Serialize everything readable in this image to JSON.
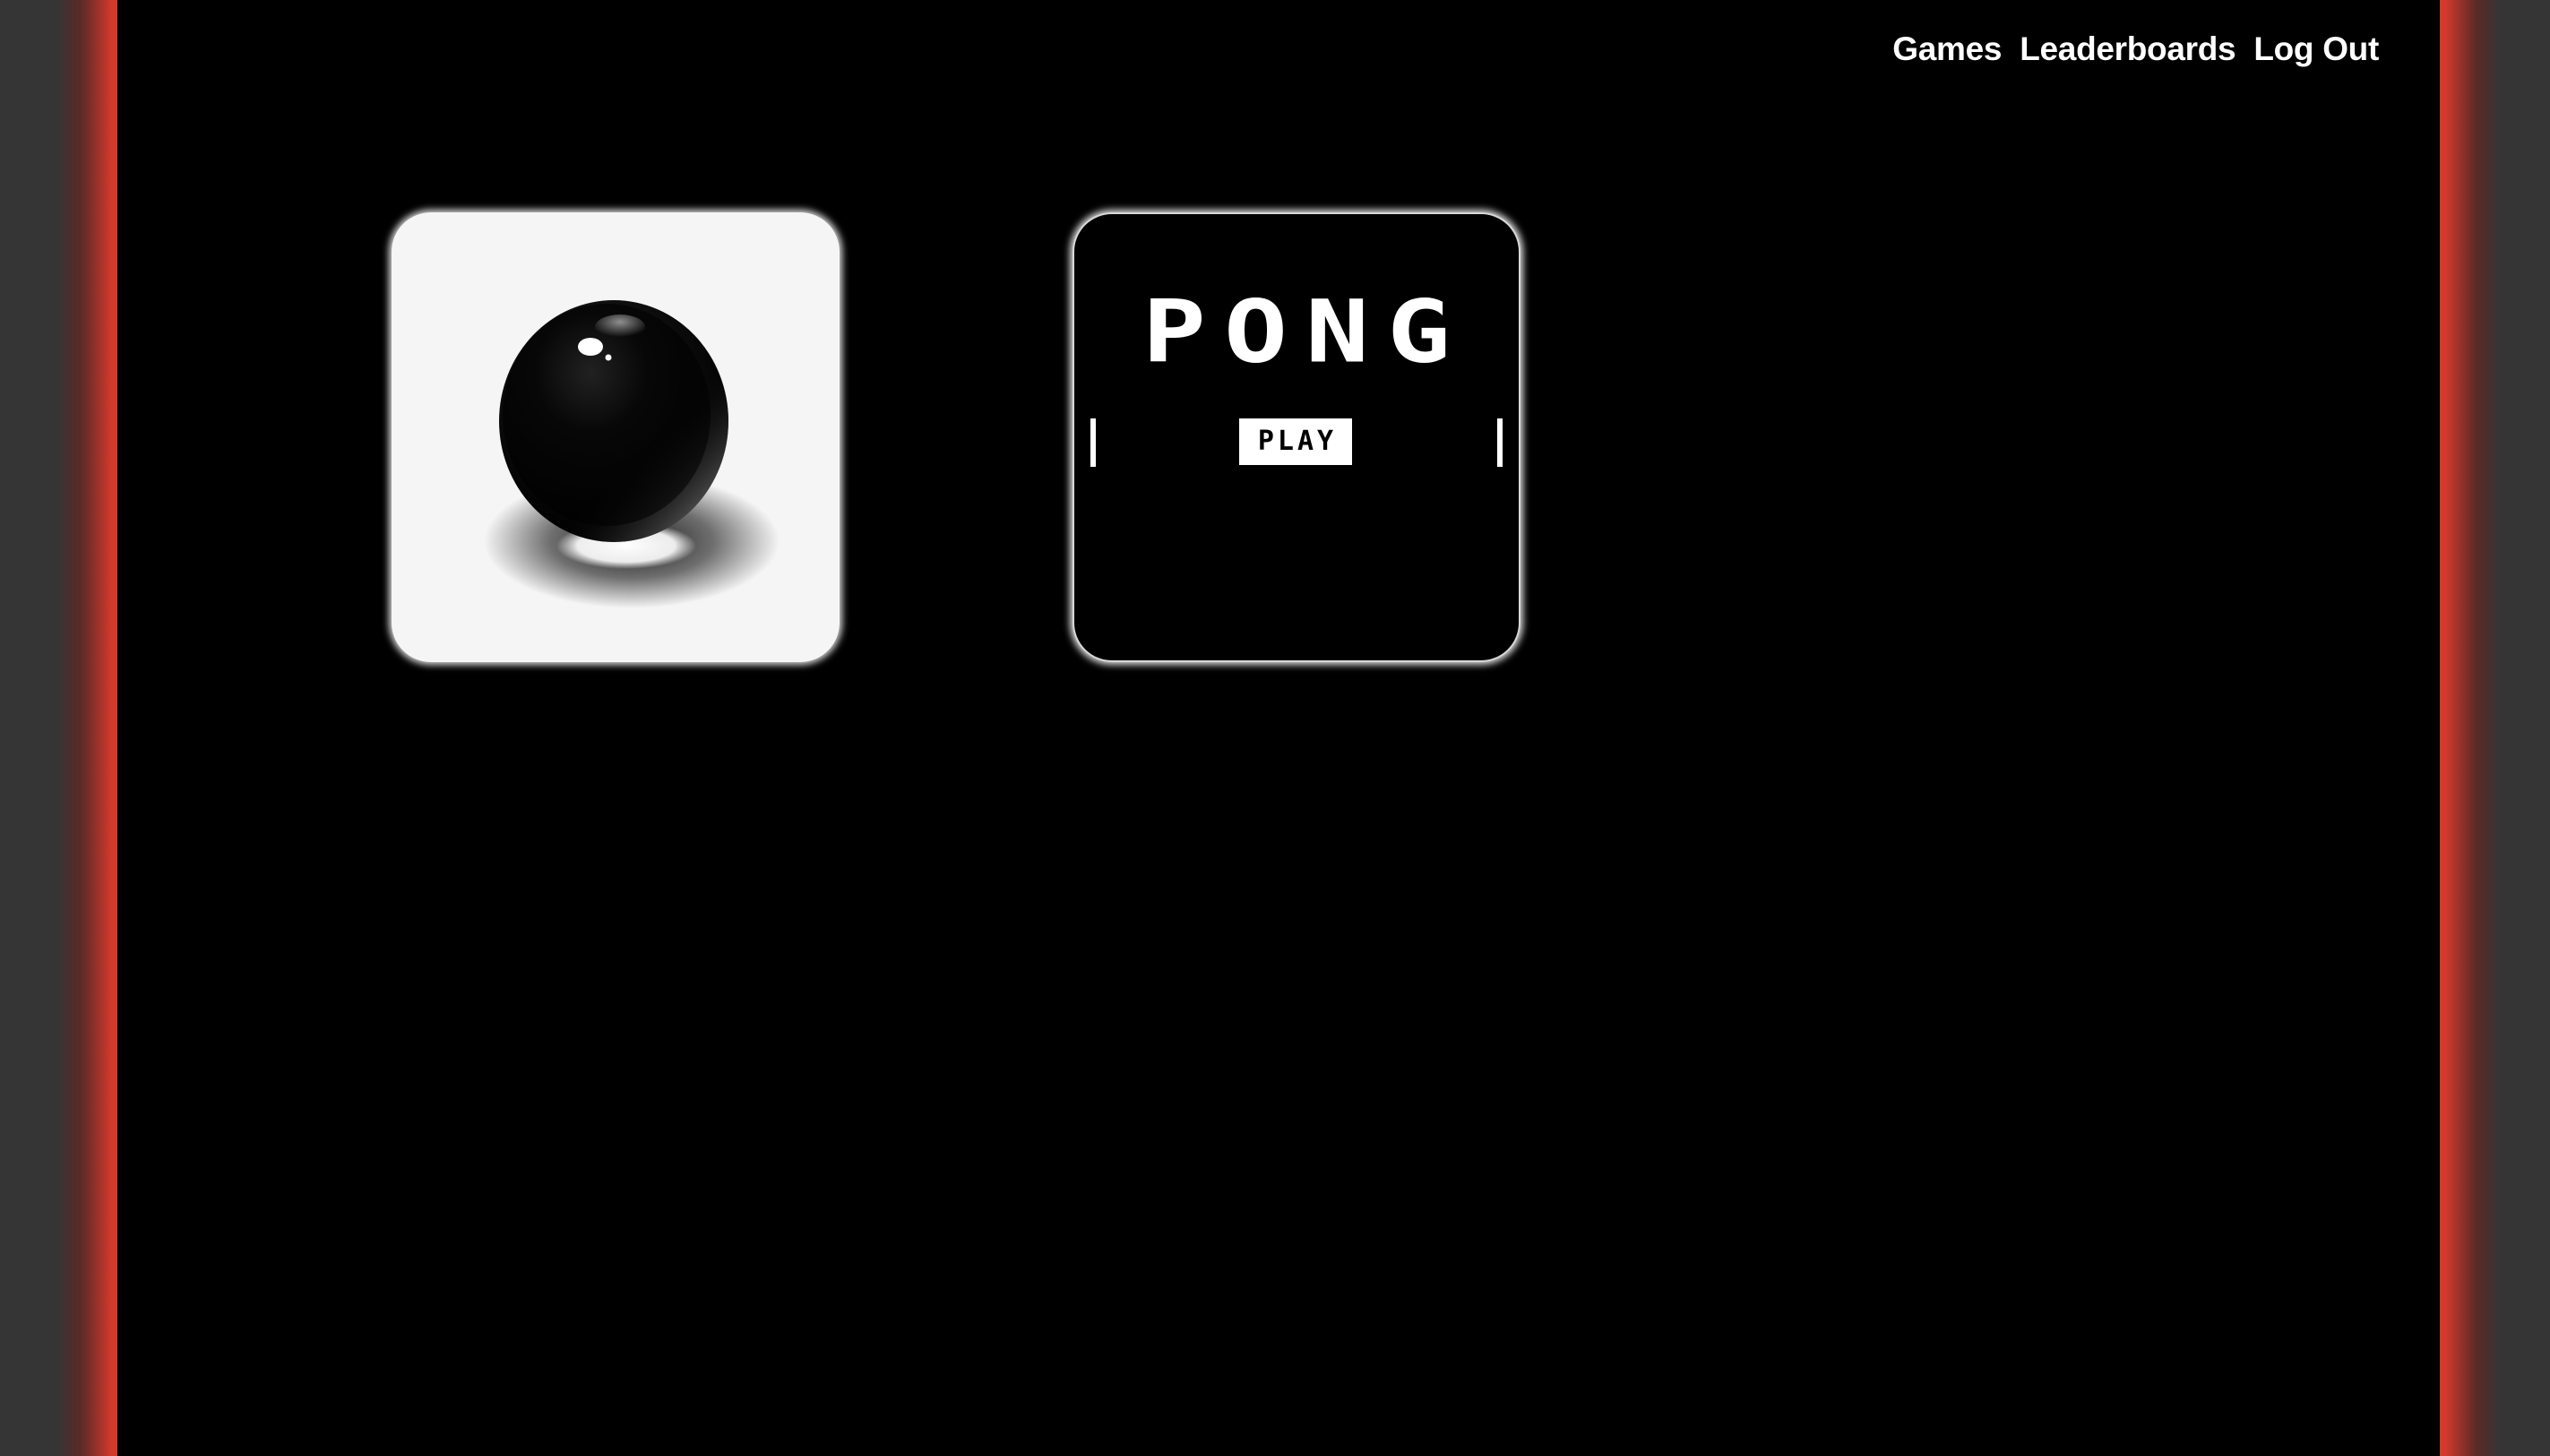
{
  "nav": {
    "games": "Games",
    "leaderboards": "Leaderboards",
    "logout": "Log Out"
  },
  "games": [
    {
      "icon": "black-ball-icon"
    },
    {
      "title": "PONG",
      "play_label": "PLAY"
    }
  ],
  "colors": {
    "background": "#000000",
    "gutter": "#353535",
    "accent": "#d23a2c",
    "nav_text": "#ffffff"
  }
}
